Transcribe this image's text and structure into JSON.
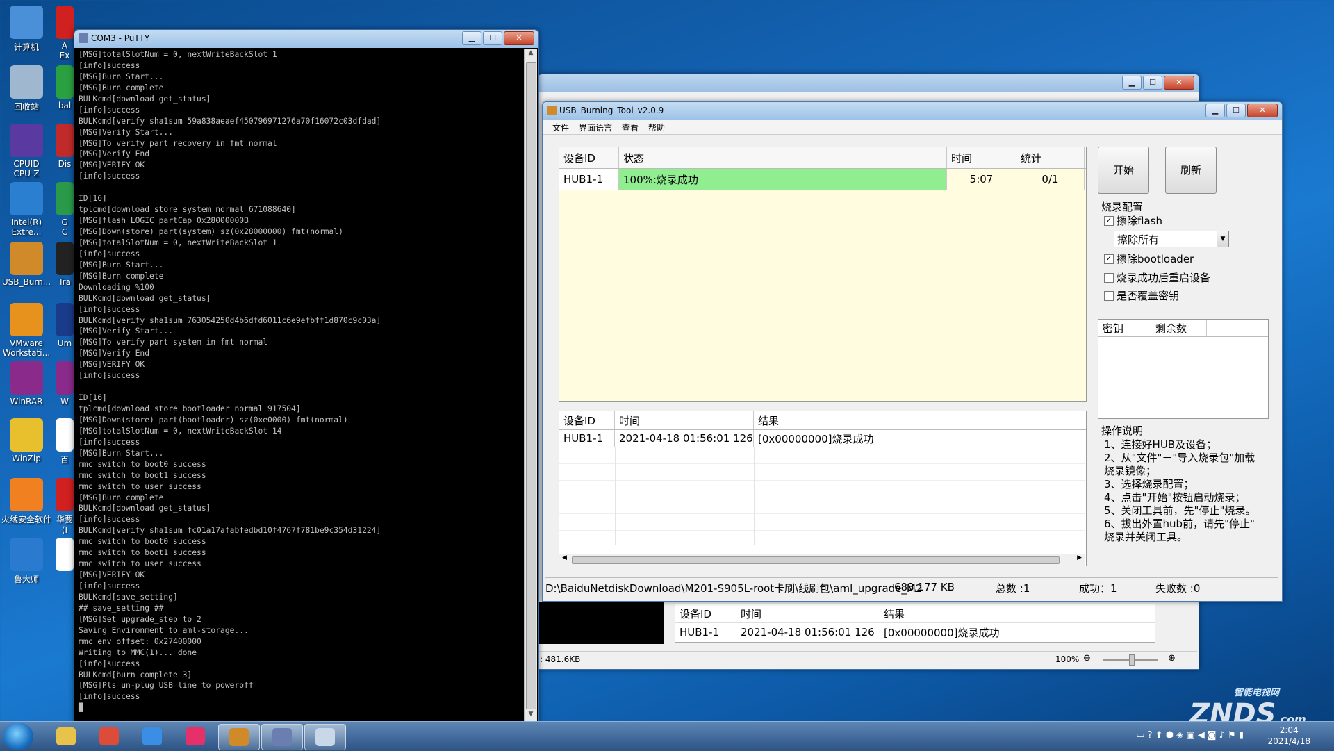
{
  "desktop": {
    "icons": [
      {
        "label": "计算机",
        "color": "#4a90d9"
      },
      {
        "label": "回收站",
        "color": "#9fb7cf"
      },
      {
        "label": "CPUID\nCPU-Z",
        "color": "#5a3aa0"
      },
      {
        "label": "Intel(R)\nExtre...",
        "color": "#2a7fd0"
      },
      {
        "label": "USB_Burn...",
        "color": "#d08a2a"
      },
      {
        "label": "VMware\nWorkstati...",
        "color": "#e8921e"
      },
      {
        "label": "WinRAR",
        "color": "#8a2a8a"
      },
      {
        "label": "WinZip",
        "color": "#e8c02e"
      },
      {
        "label": "火绒安全软件",
        "color": "#f08020"
      },
      {
        "label": "鲁大师",
        "color": "#2a7ad0"
      }
    ],
    "icons2": [
      {
        "label": "A\nEx",
        "color": "#d02020"
      },
      {
        "label": "bal",
        "color": "#2aa040"
      },
      {
        "label": "Dis",
        "color": "#c02a2a"
      },
      {
        "label": "G\nC",
        "color": "#2a9a4a"
      },
      {
        "label": "Tra",
        "color": "#222222"
      },
      {
        "label": "Um",
        "color": "#1a3a8a"
      },
      {
        "label": "W",
        "color": "#8a2a8a"
      },
      {
        "label": "百",
        "color": "#ffffff"
      },
      {
        "label": "华要\n(I",
        "color": "#d02020"
      },
      {
        "label": "",
        "color": "#ffffff"
      }
    ]
  },
  "putty": {
    "title": "COM3 - PuTTY",
    "lines": [
      "[MSG]totalSlotNum = 0, nextWriteBackSlot 1",
      "[info]success",
      "[MSG]Burn Start...",
      "[MSG]Burn complete",
      "BULKcmd[download get_status]",
      "[info]success",
      "BULKcmd[verify sha1sum 59a838aeaef450796971276a70f16072c03dfdad]",
      "[MSG]Verify Start...",
      "[MSG]To verify part recovery in fmt normal",
      "[MSG]Verify End",
      "[MSG]VERIFY OK",
      "[info]success",
      "",
      "ID[16]",
      "tplcmd[download store system normal 671088640]",
      "[MSG]flash LOGIC partCap 0x28000000B",
      "[MSG]Down(store) part(system) sz(0x28000000) fmt(normal)",
      "[MSG]totalSlotNum = 0, nextWriteBackSlot 1",
      "[info]success",
      "[MSG]Burn Start...",
      "[MSG]Burn complete",
      "Downloading %100",
      "BULKcmd[download get_status]",
      "[info]success",
      "BULKcmd[verify sha1sum 763054250d4b6dfd6011c6e9efbff1d870c9c03a]",
      "[MSG]Verify Start...",
      "[MSG]To verify part system in fmt normal",
      "[MSG]Verify End",
      "[MSG]VERIFY OK",
      "[info]success",
      "",
      "ID[16]",
      "tplcmd[download store bootloader normal 917504]",
      "[MSG]Down(store) part(bootloader) sz(0xe0000) fmt(normal)",
      "[MSG]totalSlotNum = 0, nextWriteBackSlot 14",
      "[info]success",
      "[MSG]Burn Start...",
      "mmc switch to boot0 success",
      "mmc switch to boot1 success",
      "mmc switch to user success",
      "[MSG]Burn complete",
      "BULKcmd[download get_status]",
      "[info]success",
      "BULKcmd[verify sha1sum fc01a17afabfedbd10f4767f781be9c354d31224]",
      "mmc switch to boot0 success",
      "mmc switch to boot1 success",
      "mmc switch to user success",
      "[MSG]VERIFY OK",
      "[info]success",
      "BULKcmd[save_setting]",
      "## save_setting ##",
      "[MSG]Set upgrade_step to 2",
      "Saving Environment to aml-storage...",
      "mmc env offset: 0x27400000",
      "Writing to MMC(1)... done",
      "[info]success",
      "BULKcmd[burn_complete 3]",
      "[MSG]Pls un-plug USB line to poweroff",
      "[info]success",
      "█"
    ]
  },
  "bgwindow": {
    "table_headers": [
      "设备ID",
      "时间",
      "结果"
    ],
    "table_row": [
      "HUB1-1",
      "2021-04-18 01:56:01 126",
      "[0x00000000]烧录成功"
    ],
    "status_size": ": 481.6KB",
    "zoom": "100%"
  },
  "usb": {
    "title": "USB_Burning_Tool_v2.0.9",
    "menu": [
      "文件",
      "界面语言",
      "查看",
      "帮助"
    ],
    "grid_headers": [
      "设备ID",
      "状态",
      "时间",
      "统计"
    ],
    "grid_row": {
      "id": "HUB1-1",
      "status": "100%:烧录成功",
      "time": "5:07",
      "count": "0/1"
    },
    "start_button": "开始",
    "refresh_button": "刷新",
    "config_label": "烧录配置",
    "erase_flash": "擦除flash",
    "erase_mode": "擦除所有",
    "erase_bootloader": "擦除bootloader",
    "reboot_after": "烧录成功后重启设备",
    "overwrite_key": "是否覆盖密钥",
    "key_headers": [
      "密钥",
      "剩余数"
    ],
    "log_headers": [
      "设备ID",
      "时间",
      "结果"
    ],
    "log_row": [
      "HUB1-1",
      "2021-04-18 01:56:01 126",
      "[0x00000000]烧录成功"
    ],
    "help_label": "操作说明",
    "help_text": "1、连接好HUB及设备；\n2、从\"文件\"－\"导入烧录包\"加载\n烧录镜像；\n3、选择烧录配置；\n4、点击\"开始\"按钮启动烧录；\n5、关闭工具前，先\"停止\"烧录。\n6、拔出外置hub前，请先\"停止\"\n烧录并关闭工具。",
    "status_path": "D:\\BaiduNetdiskDownload\\M201-S905L-root卡刷\\线刷包\\aml_upgrade_M2",
    "status_size": "683,177 KB",
    "status_total": "总数 :1",
    "status_success": "成功：1",
    "status_fail": "失败数 :0",
    "colors": {
      "success": "#90ee90",
      "grid_bg": "#fffce0"
    }
  },
  "taskbar": {
    "time": "2:04",
    "date": "2021/4/18",
    "buttons": [
      {
        "name": "explorer",
        "color": "#e8c24a"
      },
      {
        "name": "chrome",
        "color": "#dd4b39"
      },
      {
        "name": "baidu-netdisk",
        "color": "#3a8ee6"
      },
      {
        "name": "youku",
        "color": "#e6306a"
      },
      {
        "name": "usb-burning-tool",
        "color": "#d08a2a"
      },
      {
        "name": "putty",
        "color": "#6a7fb0"
      },
      {
        "name": "paint",
        "color": "#c8d8e8"
      }
    ]
  },
  "watermark": {
    "text": "ZNDS",
    "sub": "智能电视网",
    "domain": ".com"
  }
}
